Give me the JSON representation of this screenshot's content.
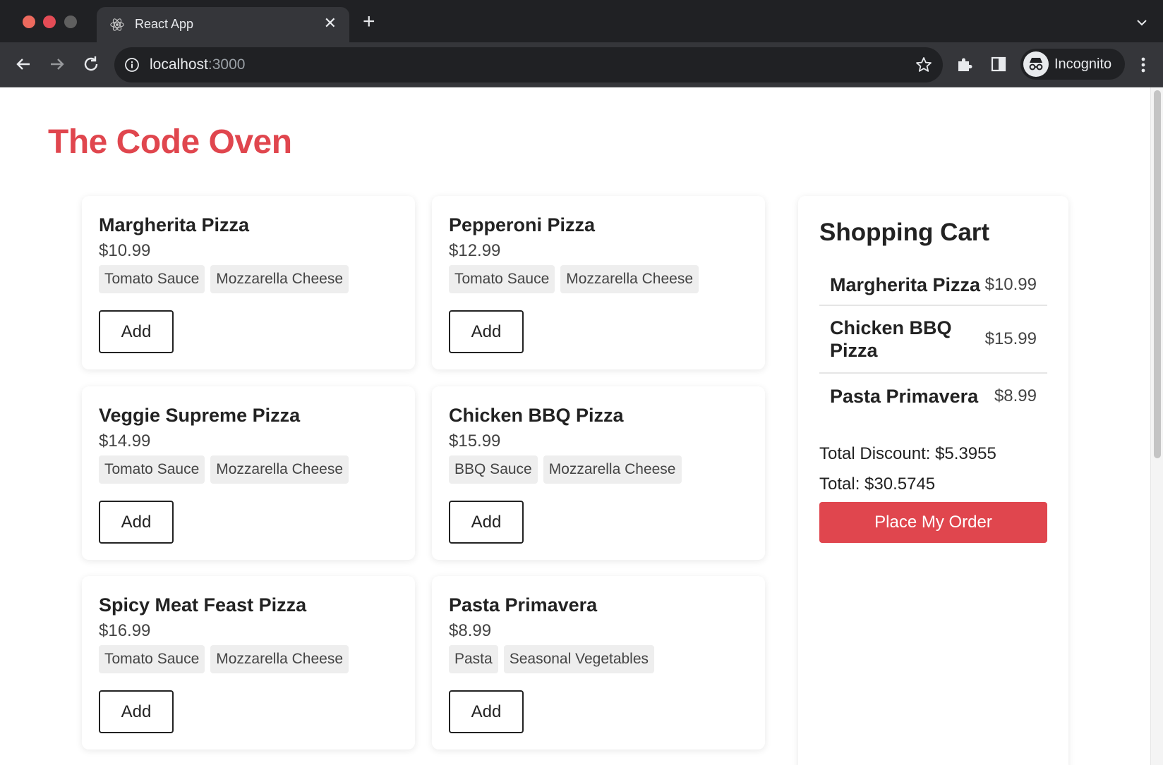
{
  "browser": {
    "tab_title": "React App",
    "url_host": "localhost",
    "url_port": ":3000",
    "profile_label": "Incognito"
  },
  "app": {
    "title": "The Code Oven",
    "accent_color": "#e0464e"
  },
  "menu": [
    {
      "name": "Margherita Pizza",
      "price": "$10.99",
      "ingredients": [
        "Tomato Sauce",
        "Mozzarella Cheese"
      ],
      "add_label": "Add"
    },
    {
      "name": "Pepperoni Pizza",
      "price": "$12.99",
      "ingredients": [
        "Tomato Sauce",
        "Mozzarella Cheese"
      ],
      "add_label": "Add"
    },
    {
      "name": "Veggie Supreme Pizza",
      "price": "$14.99",
      "ingredients": [
        "Tomato Sauce",
        "Mozzarella Cheese"
      ],
      "add_label": "Add"
    },
    {
      "name": "Chicken BBQ Pizza",
      "price": "$15.99",
      "ingredients": [
        "BBQ Sauce",
        "Mozzarella Cheese"
      ],
      "add_label": "Add"
    },
    {
      "name": "Spicy Meat Feast Pizza",
      "price": "$16.99",
      "ingredients": [
        "Tomato Sauce",
        "Mozzarella Cheese"
      ],
      "add_label": "Add"
    },
    {
      "name": "Pasta Primavera",
      "price": "$8.99",
      "ingredients": [
        "Pasta",
        "Seasonal Vegetables"
      ],
      "add_label": "Add"
    }
  ],
  "cart": {
    "title": "Shopping Cart",
    "items": [
      {
        "name": "Margherita Pizza",
        "price": "$10.99"
      },
      {
        "name": "Chicken BBQ Pizza",
        "price": "$15.99"
      },
      {
        "name": "Pasta Primavera",
        "price": "$8.99"
      }
    ],
    "discount_text": "Total Discount: $5.3955",
    "total_text": "Total: $30.5745",
    "order_button_label": "Place My Order"
  }
}
